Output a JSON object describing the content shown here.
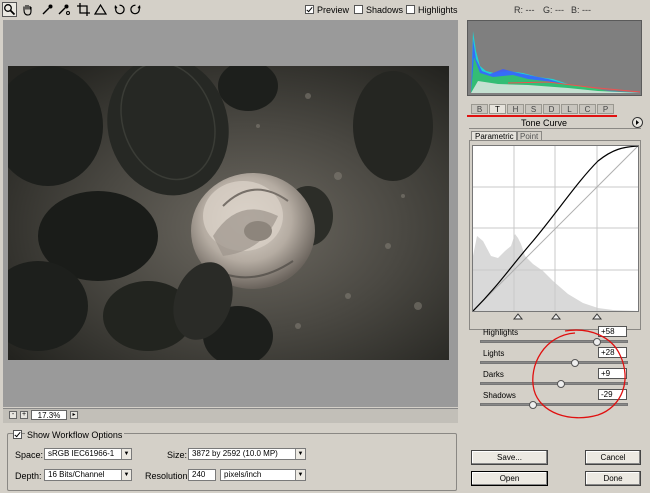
{
  "toolbar": {
    "tools": [
      "zoom-icon",
      "hand-icon",
      "white-balance-eyedropper-icon",
      "color-sampler-icon",
      "crop-icon",
      "straighten-icon",
      "rotate-left-icon",
      "rotate-right-icon"
    ],
    "preview": {
      "label": "Preview",
      "checked": true
    },
    "shadows": {
      "label": "Shadows",
      "checked": false
    },
    "highlights": {
      "label": "Highlights",
      "checked": false
    },
    "rgb": {
      "r": "R:",
      "r_val": "---",
      "g": "G:",
      "g_val": "---",
      "b": "B:",
      "b_val": "---"
    }
  },
  "preview": {
    "zoom": "17.3%",
    "zoom_out": "-",
    "zoom_in": "+"
  },
  "workflow": {
    "show_label": "Show Workflow Options",
    "checked": true,
    "space_label": "Space:",
    "space_value": "sRGB IEC61966-1",
    "depth_label": "Depth:",
    "depth_value": "16 Bits/Channel",
    "size_label": "Size:",
    "size_value": "3872 by 2592  (10.0 MP)",
    "resolution_label": "Resolution:",
    "resolution_value": "240",
    "resolution_unit": "pixels/inch"
  },
  "panel": {
    "tabs": [
      "B",
      "T",
      "H",
      "S",
      "D",
      "L",
      "C",
      "P"
    ],
    "active_tab": 1,
    "title": "Tone Curve",
    "subtabs": [
      "Parametric",
      "Point"
    ],
    "sliders": [
      {
        "label": "Highlights",
        "value": "+58",
        "level": 0.79
      },
      {
        "label": "Lights",
        "value": "+28",
        "level": 0.64
      },
      {
        "label": "Darks",
        "value": "+9",
        "level": 0.55
      },
      {
        "label": "Shadows",
        "value": "-29",
        "level": 0.36
      }
    ],
    "split_points": [
      0.25,
      0.5,
      0.75
    ]
  },
  "buttons": {
    "save": "Save...",
    "cancel": "Cancel",
    "open": "Open",
    "done": "Done"
  },
  "colors": {
    "annotation": "#e01010",
    "histogram_bg": "#7f7f7f"
  }
}
